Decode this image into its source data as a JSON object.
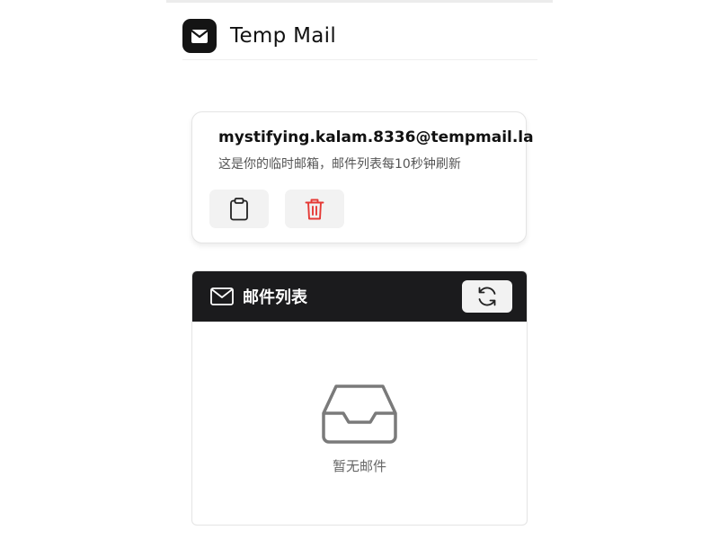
{
  "app": {
    "title": "Temp Mail",
    "logo_icon": "envelope-icon",
    "brand_color": "#141414"
  },
  "email_card": {
    "address": "mystifying.kalam.8336@tempmail.la",
    "hint": "这是你的临时邮箱，邮件列表每10秒钟刷新",
    "copy_icon": "clipboard-icon",
    "delete_icon": "trash-icon",
    "delete_color": "#e53935"
  },
  "inbox": {
    "title": "邮件列表",
    "header_icon": "mail-icon",
    "refresh_icon": "refresh-icon",
    "header_color": "#1b1b1d",
    "empty_icon": "inbox-tray-icon",
    "empty_text": "暂无邮件"
  }
}
